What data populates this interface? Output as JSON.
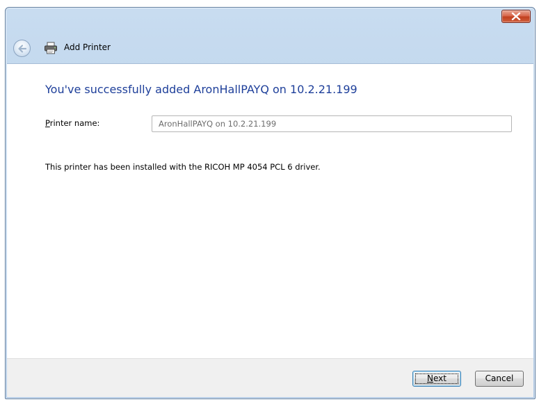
{
  "window": {
    "title": "Add Printer",
    "close_icon": "close-icon",
    "back_icon": "back-arrow-icon",
    "printer_icon": "printer-icon"
  },
  "content": {
    "heading": "You've successfully added AronHallPAYQ on 10.2.21.199",
    "printer_name_label_first": "P",
    "printer_name_label_rest": "rinter name:",
    "printer_name_value": "AronHallPAYQ on 10.2.21.199",
    "info": "This printer has been installed with the RICOH MP 4054 PCL 6 driver."
  },
  "footer": {
    "next_label_first": "N",
    "next_label_rest": "ext",
    "cancel_label": "Cancel"
  },
  "colors": {
    "heading": "#1e3f9a",
    "titlebar": "#b9d1ea",
    "close_button": "#d9694f"
  }
}
